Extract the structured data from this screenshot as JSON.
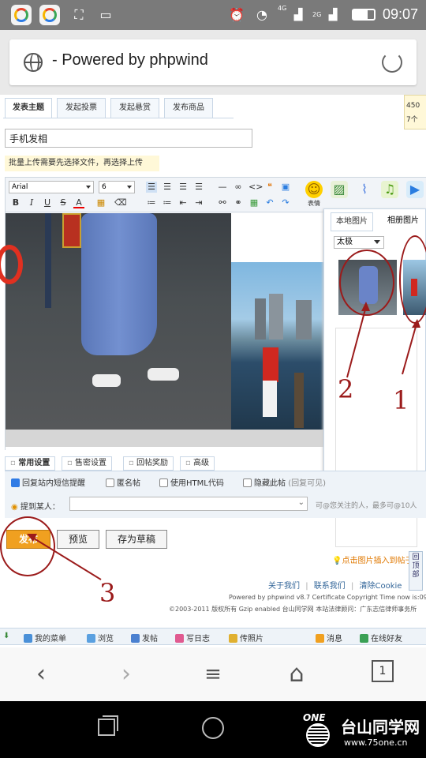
{
  "status_bar": {
    "time": "09:07",
    "network1": "4G",
    "network2": "2G"
  },
  "address_bar": {
    "title": "- Powered by phpwind"
  },
  "post_tabs": [
    "发表主题",
    "发起投票",
    "发起悬赏",
    "发布商品"
  ],
  "tip_text": "450\n7个",
  "title_input": {
    "value": "手机发相"
  },
  "upload_note": "批量上传需要先选择文件，再选择上传",
  "editor": {
    "font_family": "Arial",
    "font_size": "6",
    "toolbar_big": [
      "表情",
      "",
      "",
      "",
      ""
    ]
  },
  "image_panel": {
    "tabs": [
      "本地图片",
      "相册图片"
    ],
    "folder": "太极",
    "insert_tip": "点击图片插入到帖子"
  },
  "settings_tabs": [
    "常用设置",
    "售密设置",
    "回帖奖励",
    "高级"
  ],
  "checkboxes": [
    {
      "label": "回复站内短信提醒",
      "checked": true
    },
    {
      "label": "匿名帖",
      "checked": false
    },
    {
      "label": "使用HTML代码",
      "checked": false
    },
    {
      "label": "隐藏此帖",
      "checked": false,
      "note": "(回复可见)"
    }
  ],
  "remind": {
    "label": "提到某人：",
    "note": "可@您关注的人，最多可@10人"
  },
  "actions": {
    "post": "发布",
    "preview": "预览",
    "draft": "存为草稿"
  },
  "back_to_top": "回\n顶\n部",
  "footer": {
    "links": [
      "关于我们",
      "联系我们",
      "清除Cookie"
    ],
    "powered": "Powered by phpwind v8.7 Certificate Copyright Time now is:09",
    "copyright": "©2003-2011 版权所有 Gzip enabled 台山同学网 本站法律顾问：广东志信律师事务所"
  },
  "site_bar": [
    "我的菜单",
    "浏览",
    "发帖",
    "写日志",
    "传照片",
    "消息",
    "在线好友"
  ],
  "browser_nav": {
    "tab_count": "1"
  },
  "watermark": {
    "logo": "ONE",
    "name": "台山同学网",
    "url": "www.75one.cn"
  },
  "annotations": [
    "2",
    "1",
    "3"
  ]
}
